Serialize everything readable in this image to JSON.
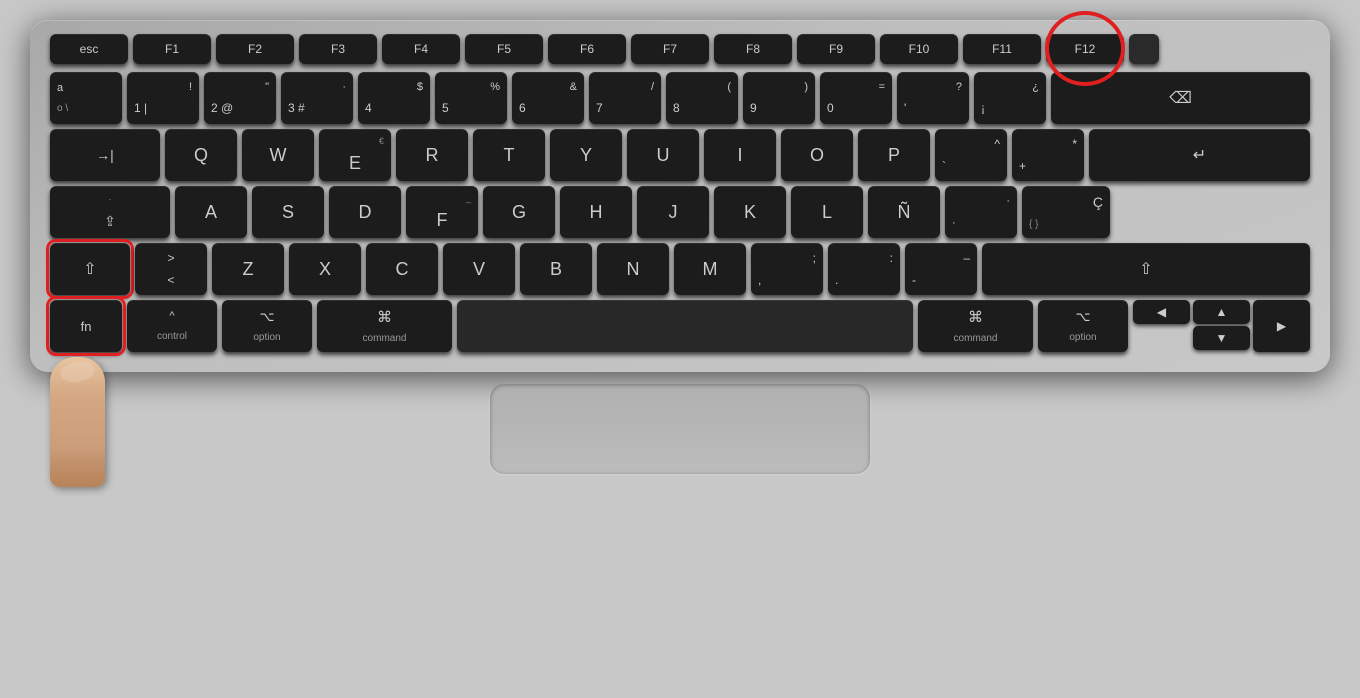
{
  "keyboard": {
    "fn_row": [
      {
        "id": "esc",
        "label": "esc",
        "size": "esc"
      },
      {
        "id": "f1",
        "label": "F1",
        "size": "fn"
      },
      {
        "id": "f2",
        "label": "F2",
        "size": "fn"
      },
      {
        "id": "f3",
        "label": "F3",
        "size": "fn"
      },
      {
        "id": "f4",
        "label": "F4",
        "size": "fn"
      },
      {
        "id": "f5",
        "label": "F5",
        "size": "fn"
      },
      {
        "id": "f6",
        "label": "F6",
        "size": "fn"
      },
      {
        "id": "f7",
        "label": "F7",
        "size": "fn"
      },
      {
        "id": "f8",
        "label": "F8",
        "size": "fn"
      },
      {
        "id": "f9",
        "label": "F9",
        "size": "fn"
      },
      {
        "id": "f10",
        "label": "F10",
        "size": "fn"
      },
      {
        "id": "f11",
        "label": "F11",
        "size": "fn"
      },
      {
        "id": "f12",
        "label": "F12",
        "size": "fn",
        "highlight": "red-circle"
      }
    ],
    "row1": [
      {
        "id": "grave",
        "top": "a",
        "bottom": "o \\",
        "size": "std"
      },
      {
        "id": "1",
        "top": "!",
        "bottom": "1 |",
        "size": "std"
      },
      {
        "id": "2",
        "top": "\"",
        "bottom": "2 @",
        "size": "std"
      },
      {
        "id": "3",
        "top": "·",
        "bottom": "3 #",
        "size": "std"
      },
      {
        "id": "4",
        "top": "$",
        "bottom": "4",
        "size": "std"
      },
      {
        "id": "5",
        "top": "%",
        "bottom": "5",
        "size": "std"
      },
      {
        "id": "6",
        "top": "&",
        "bottom": "6",
        "size": "std"
      },
      {
        "id": "7",
        "top": "/",
        "bottom": "7",
        "size": "std"
      },
      {
        "id": "8",
        "top": "(",
        "bottom": "8",
        "size": "std"
      },
      {
        "id": "9",
        "top": ")",
        "bottom": "9",
        "size": "std"
      },
      {
        "id": "0",
        "top": "=",
        "bottom": "0",
        "size": "std"
      },
      {
        "id": "minus",
        "top": "?",
        "bottom": "'",
        "size": "std"
      },
      {
        "id": "equal",
        "top": "¿",
        "bottom": "¡",
        "size": "std"
      },
      {
        "id": "backspace",
        "top": "",
        "bottom": "⌫",
        "size": "backspace"
      }
    ],
    "row2": [
      {
        "id": "tab",
        "label": "→|",
        "size": "tab"
      },
      {
        "id": "q",
        "top": "",
        "bottom": "Q",
        "size": "std"
      },
      {
        "id": "w",
        "top": "",
        "bottom": "W",
        "size": "std"
      },
      {
        "id": "e",
        "top": "€",
        "bottom": "E",
        "size": "std"
      },
      {
        "id": "r",
        "top": "",
        "bottom": "R",
        "size": "std"
      },
      {
        "id": "t",
        "top": "",
        "bottom": "T",
        "size": "std"
      },
      {
        "id": "y",
        "top": "",
        "bottom": "Y",
        "size": "std"
      },
      {
        "id": "u",
        "top": "",
        "bottom": "U",
        "size": "std"
      },
      {
        "id": "i",
        "top": "",
        "bottom": "I",
        "size": "std"
      },
      {
        "id": "o",
        "top": "",
        "bottom": "O",
        "size": "std"
      },
      {
        "id": "p",
        "top": "",
        "bottom": "P",
        "size": "std"
      },
      {
        "id": "lbracket",
        "top": "^",
        "bottom": "`",
        "size": "std"
      },
      {
        "id": "rbracket",
        "top": "*",
        "bottom": "+",
        "size": "std"
      },
      {
        "id": "enter",
        "label": "↵",
        "size": "enter"
      }
    ],
    "row3": [
      {
        "id": "caps",
        "top": "·",
        "bottom": "⇪",
        "size": "caps"
      },
      {
        "id": "a",
        "bottom": "A",
        "size": "std"
      },
      {
        "id": "s",
        "bottom": "S",
        "size": "std"
      },
      {
        "id": "d",
        "bottom": "D",
        "size": "std"
      },
      {
        "id": "f",
        "top": "_",
        "bottom": "F",
        "size": "std"
      },
      {
        "id": "g",
        "bottom": "G",
        "size": "std"
      },
      {
        "id": "h",
        "bottom": "H",
        "size": "std"
      },
      {
        "id": "j",
        "bottom": "J",
        "size": "std"
      },
      {
        "id": "k",
        "bottom": "K",
        "size": "std"
      },
      {
        "id": "l",
        "bottom": "L",
        "size": "std"
      },
      {
        "id": "semicolon",
        "top": "Ñ",
        "bottom": "",
        "size": "std"
      },
      {
        "id": "quote",
        "top": "·",
        "bottom": "·",
        "size": "std"
      },
      {
        "id": "backslash",
        "top": "Ç",
        "bottom": "",
        "size": "std"
      }
    ],
    "row4": [
      {
        "id": "lshift",
        "label": "⇧",
        "size": "lshift",
        "highlight": "red-box"
      },
      {
        "id": "iso",
        "top": ">",
        "bottom": "<",
        "size": "iso"
      },
      {
        "id": "z",
        "bottom": "Z",
        "size": "std"
      },
      {
        "id": "x",
        "bottom": "X",
        "size": "std"
      },
      {
        "id": "c",
        "bottom": "C",
        "size": "std"
      },
      {
        "id": "v",
        "bottom": "V",
        "size": "std"
      },
      {
        "id": "b",
        "bottom": "B",
        "size": "std"
      },
      {
        "id": "n",
        "bottom": "N",
        "size": "std"
      },
      {
        "id": "m",
        "bottom": "M",
        "size": "std"
      },
      {
        "id": "comma",
        "top": ";",
        "bottom": ",",
        "size": "std"
      },
      {
        "id": "period",
        "top": ":",
        "bottom": ".",
        "size": "std"
      },
      {
        "id": "slash",
        "top": "–",
        "bottom": "-",
        "size": "std"
      },
      {
        "id": "rshift",
        "label": "⇧",
        "size": "rshift"
      }
    ],
    "row5": [
      {
        "id": "fn",
        "label": "fn",
        "size": "fn-bottom",
        "highlight": "red-box"
      },
      {
        "id": "control",
        "top": "^",
        "bottom": "control",
        "size": "control"
      },
      {
        "id": "option-l",
        "top": "⌥",
        "bottom": "option",
        "size": "option"
      },
      {
        "id": "command-l",
        "top": "⌘",
        "bottom": "command",
        "size": "command-l"
      },
      {
        "id": "space",
        "label": "",
        "size": "space"
      },
      {
        "id": "command-r",
        "top": "⌘",
        "bottom": "command",
        "size": "command-r"
      },
      {
        "id": "option-r",
        "top": "⌥",
        "bottom": "option",
        "size": "option-r"
      }
    ],
    "annotations": {
      "red_circle_key": "F12",
      "red_box_keys": [
        "fn",
        "lshift"
      ],
      "option_text": "option"
    }
  }
}
